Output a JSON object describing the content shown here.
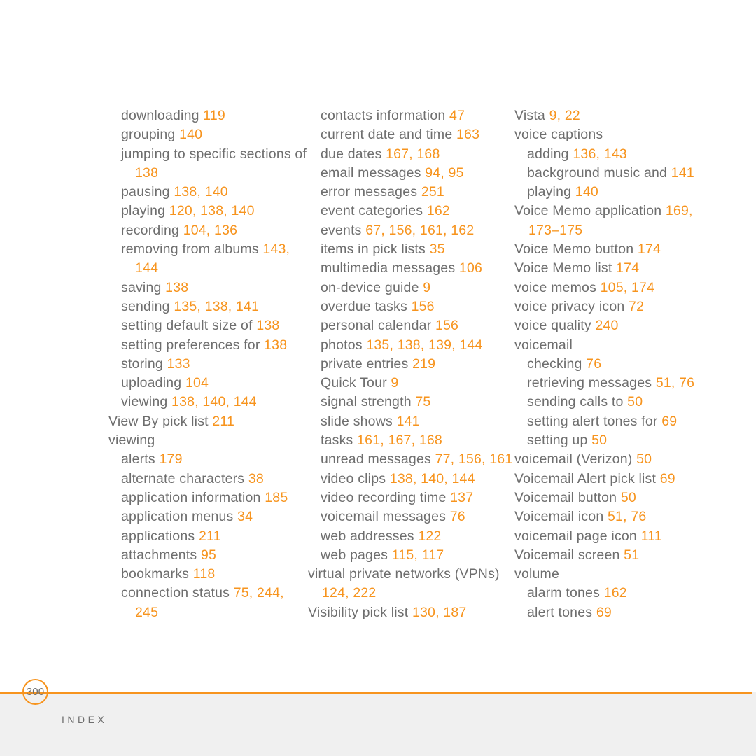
{
  "document": {
    "type": "index-page",
    "page_number": "300",
    "section_label": "INDEX",
    "accent_color": "#F7941E",
    "text_color": "#6E6E6E",
    "footer_background": "#F0F0F0"
  },
  "columns": [
    {
      "id": "column-1",
      "entries": [
        {
          "level": 1,
          "label": "downloading",
          "pages": "119"
        },
        {
          "level": 1,
          "label": "grouping",
          "pages": "140"
        },
        {
          "level": 1,
          "label": "jumping to specific sections of",
          "pages": "138"
        },
        {
          "level": 1,
          "label": "pausing",
          "pages": "138, 140"
        },
        {
          "level": 1,
          "label": "playing",
          "pages": "120, 138, 140"
        },
        {
          "level": 1,
          "label": "recording",
          "pages": "104, 136"
        },
        {
          "level": 1,
          "label": "removing from albums",
          "pages": "143, 144"
        },
        {
          "level": 1,
          "label": "saving",
          "pages": "138"
        },
        {
          "level": 1,
          "label": "sending",
          "pages": "135, 138, 141"
        },
        {
          "level": 1,
          "label": "setting default size of",
          "pages": "138"
        },
        {
          "level": 1,
          "label": "setting preferences for",
          "pages": "138"
        },
        {
          "level": 1,
          "label": "storing",
          "pages": "133"
        },
        {
          "level": 1,
          "label": "uploading",
          "pages": "104"
        },
        {
          "level": 1,
          "label": "viewing",
          "pages": "138, 140, 144"
        },
        {
          "level": 0,
          "label": "View By pick list",
          "pages": "211"
        },
        {
          "level": 0,
          "label": "viewing",
          "pages": ""
        },
        {
          "level": 1,
          "label": "alerts",
          "pages": "179"
        },
        {
          "level": 1,
          "label": "alternate characters",
          "pages": "38"
        },
        {
          "level": 1,
          "label": "application information",
          "pages": "185"
        },
        {
          "level": 1,
          "label": "application menus",
          "pages": "34"
        },
        {
          "level": 1,
          "label": "applications",
          "pages": "211"
        },
        {
          "level": 1,
          "label": "attachments",
          "pages": "95"
        },
        {
          "level": 1,
          "label": "bookmarks",
          "pages": "118"
        },
        {
          "level": 1,
          "label": "connection status",
          "pages": "75, 244, 245"
        }
      ]
    },
    {
      "id": "column-2",
      "entries": [
        {
          "level": 1,
          "label": "contacts information",
          "pages": "47"
        },
        {
          "level": 1,
          "label": "current date and time",
          "pages": "163"
        },
        {
          "level": 1,
          "label": "due dates",
          "pages": "167, 168"
        },
        {
          "level": 1,
          "label": "email messages",
          "pages": "94, 95"
        },
        {
          "level": 1,
          "label": "error messages",
          "pages": "251"
        },
        {
          "level": 1,
          "label": "event categories",
          "pages": "162"
        },
        {
          "level": 1,
          "label": "events",
          "pages": "67, 156, 161, 162"
        },
        {
          "level": 1,
          "label": "items in pick lists",
          "pages": "35"
        },
        {
          "level": 1,
          "label": "multimedia messages",
          "pages": "106"
        },
        {
          "level": 1,
          "label": "on-device guide",
          "pages": "9"
        },
        {
          "level": 1,
          "label": "overdue tasks",
          "pages": "156"
        },
        {
          "level": 1,
          "label": "personal calendar",
          "pages": "156"
        },
        {
          "level": 1,
          "label": "photos",
          "pages": "135, 138, 139, 144"
        },
        {
          "level": 1,
          "label": "private entries",
          "pages": "219"
        },
        {
          "level": 1,
          "label": "Quick Tour",
          "pages": "9"
        },
        {
          "level": 1,
          "label": "signal strength",
          "pages": "75"
        },
        {
          "level": 1,
          "label": "slide shows",
          "pages": "141"
        },
        {
          "level": 1,
          "label": "tasks",
          "pages": "161, 167, 168"
        },
        {
          "level": 1,
          "label": "unread messages",
          "pages": "77, 156, 161"
        },
        {
          "level": 1,
          "label": "video clips",
          "pages": "138, 140, 144"
        },
        {
          "level": 1,
          "label": "video recording time",
          "pages": "137"
        },
        {
          "level": 1,
          "label": "voicemail messages",
          "pages": "76"
        },
        {
          "level": 1,
          "label": "web addresses",
          "pages": "122"
        },
        {
          "level": 1,
          "label": "web pages",
          "pages": "115, 117"
        },
        {
          "level": 0,
          "label": "virtual private networks (VPNs)",
          "pages": "124, 222"
        },
        {
          "level": 0,
          "label": "Visibility pick list",
          "pages": "130, 187"
        }
      ]
    },
    {
      "id": "column-3",
      "entries": [
        {
          "level": 0,
          "label": "Vista",
          "pages": "9, 22"
        },
        {
          "level": 0,
          "label": "voice captions",
          "pages": ""
        },
        {
          "level": 1,
          "label": "adding",
          "pages": "136, 143"
        },
        {
          "level": 1,
          "label": "background music and",
          "pages": "141"
        },
        {
          "level": 1,
          "label": "playing",
          "pages": "140"
        },
        {
          "level": 0,
          "label": "Voice Memo application",
          "pages": "169, 173–175"
        },
        {
          "level": 0,
          "label": "Voice Memo button",
          "pages": "174"
        },
        {
          "level": 0,
          "label": "Voice Memo list",
          "pages": "174"
        },
        {
          "level": 0,
          "label": "voice memos",
          "pages": "105, 174"
        },
        {
          "level": 0,
          "label": "voice privacy icon",
          "pages": "72"
        },
        {
          "level": 0,
          "label": "voice quality",
          "pages": "240"
        },
        {
          "level": 0,
          "label": "voicemail",
          "pages": ""
        },
        {
          "level": 1,
          "label": "checking",
          "pages": "76"
        },
        {
          "level": 1,
          "label": "retrieving messages",
          "pages": "51, 76"
        },
        {
          "level": 1,
          "label": "sending calls to",
          "pages": "50"
        },
        {
          "level": 1,
          "label": "setting alert tones for",
          "pages": "69"
        },
        {
          "level": 1,
          "label": "setting up",
          "pages": "50"
        },
        {
          "level": 0,
          "label": "voicemail (Verizon)",
          "pages": "50"
        },
        {
          "level": 0,
          "label": "Voicemail Alert pick list",
          "pages": "69"
        },
        {
          "level": 0,
          "label": "Voicemail button",
          "pages": "50"
        },
        {
          "level": 0,
          "label": "Voicemail icon",
          "pages": "51, 76"
        },
        {
          "level": 0,
          "label": "voicemail page icon",
          "pages": "111"
        },
        {
          "level": 0,
          "label": "Voicemail screen",
          "pages": "51"
        },
        {
          "level": 0,
          "label": "volume",
          "pages": ""
        },
        {
          "level": 1,
          "label": "alarm tones",
          "pages": "162"
        },
        {
          "level": 1,
          "label": "alert tones",
          "pages": "69"
        }
      ]
    }
  ]
}
